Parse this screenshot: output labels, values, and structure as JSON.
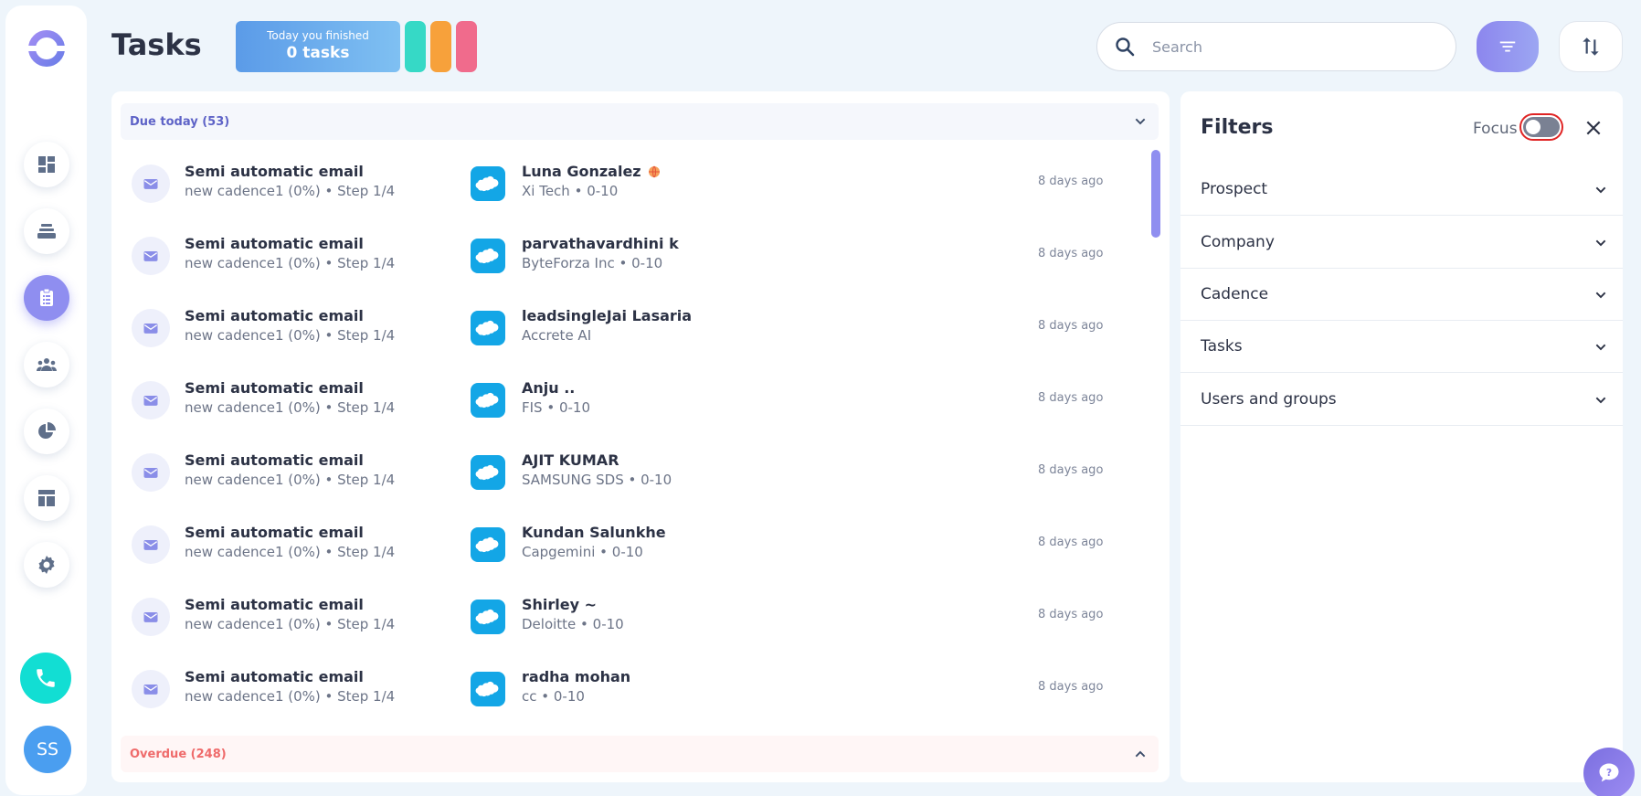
{
  "header": {
    "title": "Tasks",
    "finished": {
      "line1": "Today you finished",
      "line2": "0 tasks"
    },
    "pill_colors": [
      "#36d9c6",
      "#f7a13b",
      "#f06b8c"
    ],
    "search_placeholder": "Search"
  },
  "sidebar": {
    "items": [
      "dashboard-icon",
      "inbox-stack-icon",
      "tasks-clipboard-icon",
      "people-icon",
      "pie-chart-icon",
      "layout-icon",
      "gear-icon"
    ],
    "active": "tasks-clipboard-icon",
    "avatar_initials": "SS"
  },
  "groups": {
    "due_today": "Due today (53)",
    "overdue": "Overdue (248)"
  },
  "tasks": [
    {
      "title": "Semi automatic email",
      "subtitle": "new cadence1 (0%) • Step 1/4",
      "prospect": "Luna Gonzalez",
      "company": "Xi Tech • 0-10",
      "time": "8 days ago",
      "globe": true
    },
    {
      "title": "Semi automatic email",
      "subtitle": "new cadence1 (0%) • Step 1/4",
      "prospect": "parvathavardhini k",
      "company": "ByteForza Inc • 0-10",
      "time": "8 days ago",
      "globe": false
    },
    {
      "title": "Semi automatic email",
      "subtitle": "new cadence1 (0%) • Step 1/4",
      "prospect": "leadsingleJai Lasaria",
      "company": "Accrete AI",
      "time": "8 days ago",
      "globe": false
    },
    {
      "title": "Semi automatic email",
      "subtitle": "new cadence1 (0%) • Step 1/4",
      "prospect": "Anju ..",
      "company": "FIS • 0-10",
      "time": "8 days ago",
      "globe": false
    },
    {
      "title": "Semi automatic email",
      "subtitle": "new cadence1 (0%) • Step 1/4",
      "prospect": "AJIT KUMAR",
      "company": "SAMSUNG SDS • 0-10",
      "time": "8 days ago",
      "globe": false
    },
    {
      "title": "Semi automatic email",
      "subtitle": "new cadence1 (0%) • Step 1/4",
      "prospect": "Kundan Salunkhe",
      "company": "Capgemini • 0-10",
      "time": "8 days ago",
      "globe": false
    },
    {
      "title": "Semi automatic email",
      "subtitle": "new cadence1 (0%) • Step 1/4",
      "prospect": "Shirley ~",
      "company": "Deloitte • 0-10",
      "time": "8 days ago",
      "globe": false
    },
    {
      "title": "Semi automatic email",
      "subtitle": "new cadence1 (0%) • Step 1/4",
      "prospect": "radha mohan",
      "company": "cc • 0-10",
      "time": "8 days ago",
      "globe": false
    }
  ],
  "filters": {
    "title": "Filters",
    "focus_label": "Focus",
    "focus_on": false,
    "sections": [
      "Prospect",
      "Company",
      "Cadence",
      "Tasks",
      "Users and groups"
    ]
  },
  "colors": {
    "accent": "#8f8ef0",
    "salesforce": "#13a6e6",
    "overdue": "#ef6b6b",
    "due": "#5e63c7"
  }
}
